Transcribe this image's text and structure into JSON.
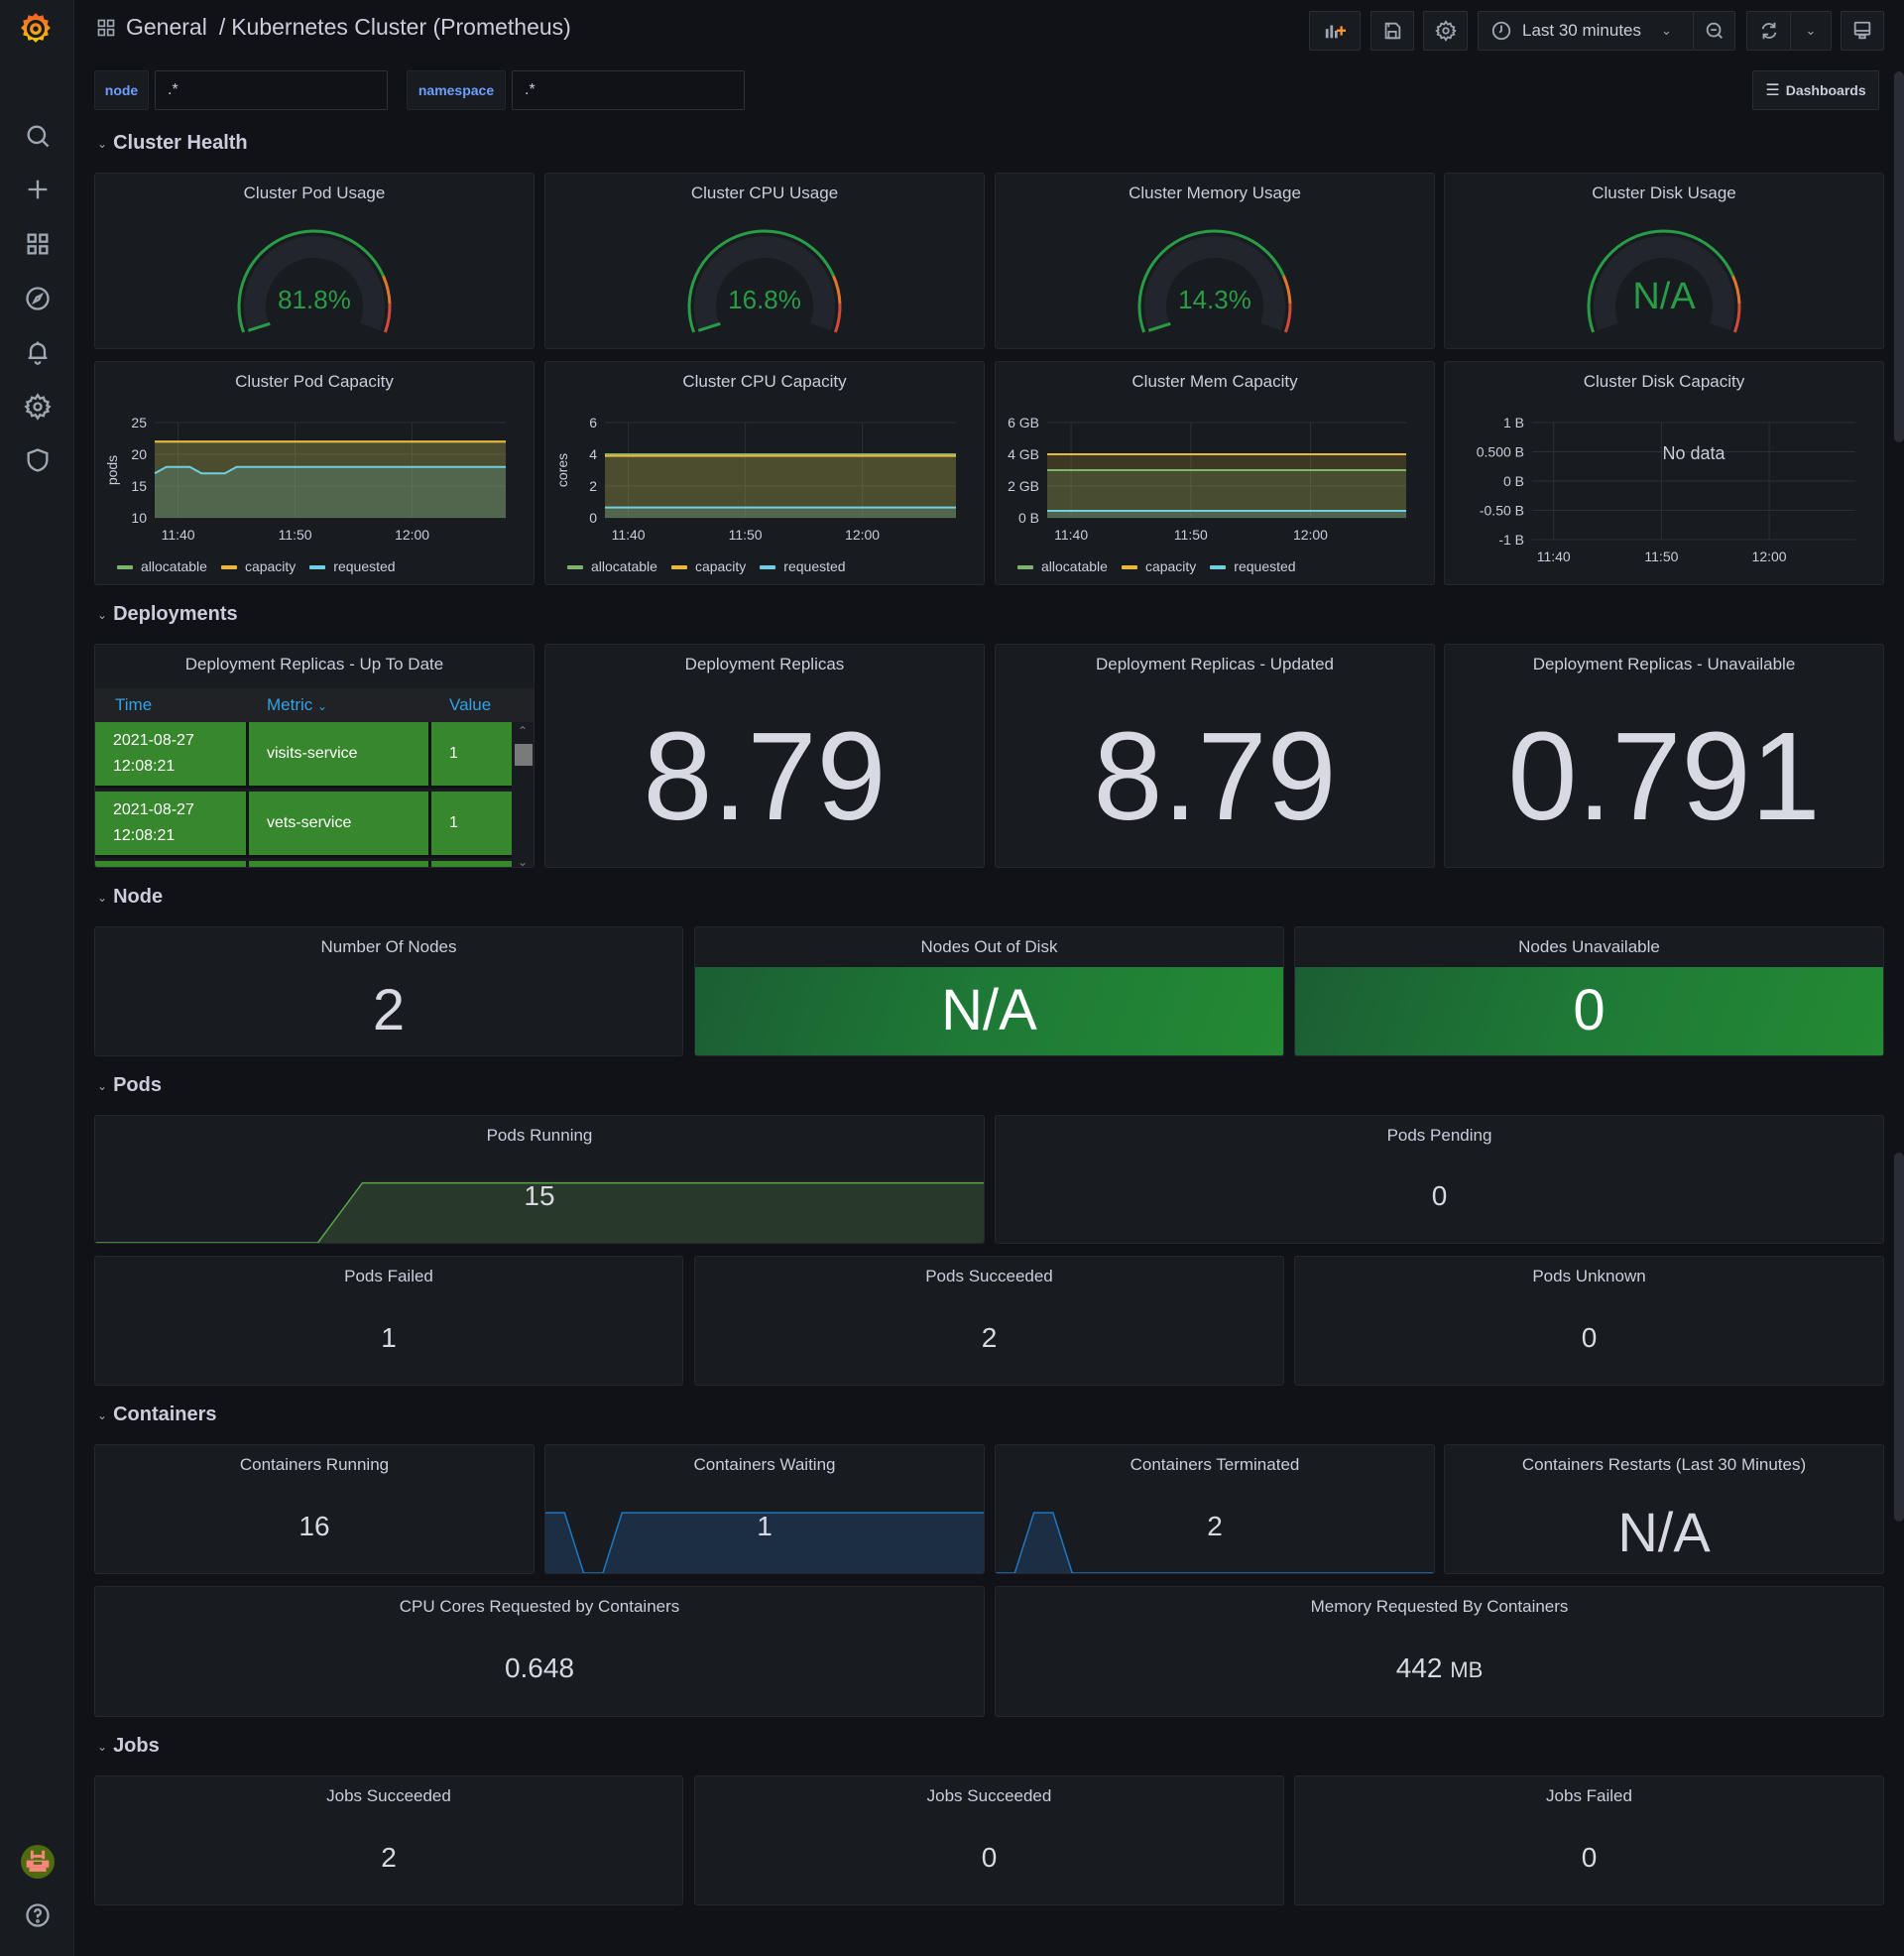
{
  "header": {
    "breadcrumb_folder": "General",
    "breadcrumb_sep": "/",
    "dashboard_title": "Kubernetes Cluster (Prometheus)",
    "time_range": "Last 30 minutes",
    "dashboards_button": "Dashboards"
  },
  "variables": [
    {
      "label": "node",
      "value": ".*"
    },
    {
      "label": "namespace",
      "value": ".*"
    }
  ],
  "sidebar": {
    "items": [
      "search",
      "create",
      "dashboards",
      "explore",
      "alerting",
      "configuration",
      "server-admin"
    ],
    "bottom": [
      "profile",
      "help"
    ]
  },
  "rows": {
    "cluster_health": "Cluster Health",
    "deployments": "Deployments",
    "node": "Node",
    "pods": "Pods",
    "containers": "Containers",
    "jobs": "Jobs"
  },
  "gauges": [
    {
      "title": "Cluster Pod Usage",
      "value": "81.8%",
      "percent": 81.8
    },
    {
      "title": "Cluster CPU Usage",
      "value": "16.8%",
      "percent": 16.8
    },
    {
      "title": "Cluster Memory Usage",
      "value": "14.3%",
      "percent": 14.3
    },
    {
      "title": "Cluster Disk Usage",
      "value": "N/A",
      "percent": null
    }
  ],
  "gauge_thresholds": {
    "green": "#299c46",
    "orange": "#e0752d",
    "red": "#d44a3a",
    "orange_from": 80,
    "red_from": 90
  },
  "chart_data": [
    {
      "type": "line",
      "title": "Cluster Pod Capacity",
      "ylabel": "pods",
      "x": [
        "11:38",
        "11:39",
        "11:40",
        "11:41",
        "11:42",
        "11:43",
        "11:44",
        "11:45",
        "11:50",
        "12:00",
        "12:08"
      ],
      "xticks": [
        "11:40",
        "11:50",
        "12:00"
      ],
      "yticks": [
        "10",
        "15",
        "20",
        "25"
      ],
      "ylim": [
        10,
        25
      ],
      "series": [
        {
          "name": "allocatable",
          "color": "#7eb26d",
          "values": [
            22,
            22,
            22,
            22,
            22,
            22,
            22,
            22,
            22,
            22,
            22
          ]
        },
        {
          "name": "capacity",
          "color": "#eab839",
          "values": [
            22,
            22,
            22,
            22,
            22,
            22,
            22,
            22,
            22,
            22,
            22
          ]
        },
        {
          "name": "requested",
          "color": "#6ed0e0",
          "values": [
            17,
            18,
            18,
            18,
            17,
            17,
            17,
            18,
            18,
            18,
            18
          ]
        }
      ]
    },
    {
      "type": "line",
      "title": "Cluster CPU Capacity",
      "ylabel": "cores",
      "x": [
        "11:38",
        "12:08"
      ],
      "xticks": [
        "11:40",
        "11:50",
        "12:00"
      ],
      "yticks": [
        "0",
        "2",
        "4",
        "6"
      ],
      "ylim": [
        0,
        6
      ],
      "series": [
        {
          "name": "allocatable",
          "color": "#7eb26d",
          "values": [
            4,
            4
          ]
        },
        {
          "name": "capacity",
          "color": "#eab839",
          "values": [
            3.9,
            3.9
          ]
        },
        {
          "name": "requested",
          "color": "#6ed0e0",
          "values": [
            0.65,
            0.65
          ]
        }
      ]
    },
    {
      "type": "line",
      "title": "Cluster Mem Capacity",
      "ylabel": "",
      "x": [
        "11:38",
        "12:08"
      ],
      "xticks": [
        "11:40",
        "11:50",
        "12:00"
      ],
      "yticks": [
        "0 B",
        "2 GB",
        "4 GB",
        "6 GB"
      ],
      "ylim": [
        0,
        6
      ],
      "series": [
        {
          "name": "allocatable",
          "color": "#7eb26d",
          "values": [
            3.0,
            3.0
          ]
        },
        {
          "name": "capacity",
          "color": "#eab839",
          "values": [
            4.0,
            4.0
          ]
        },
        {
          "name": "requested",
          "color": "#6ed0e0",
          "values": [
            0.44,
            0.44
          ]
        }
      ]
    },
    {
      "type": "line",
      "title": "Cluster Disk Capacity",
      "ylabel": "",
      "x": [],
      "xticks": [
        "11:40",
        "11:50",
        "12:00"
      ],
      "yticks": [
        "-1 B",
        "-0.50 B",
        "0 B",
        "0.500 B",
        "1 B"
      ],
      "ylim": [
        -1,
        1
      ],
      "no_data": "No data",
      "series": []
    }
  ],
  "deployments": {
    "table": {
      "title": "Deployment Replicas - Up To Date",
      "columns": [
        "Time",
        "Metric",
        "Value"
      ],
      "rows": [
        {
          "time": "2021-08-27 12:08:21",
          "time_date": "2021-08-27",
          "time_clock": "12:08:21",
          "metric": "visits-service",
          "value": "1"
        },
        {
          "time": "2021-08-27 12:08:21",
          "time_date": "2021-08-27",
          "time_clock": "12:08:21",
          "metric": "vets-service",
          "value": "1"
        }
      ]
    },
    "stats": [
      {
        "title": "Deployment Replicas",
        "value": "8.79"
      },
      {
        "title": "Deployment Replicas - Updated",
        "value": "8.79"
      },
      {
        "title": "Deployment Replicas - Unavailable",
        "value": "0.791"
      }
    ]
  },
  "node": [
    {
      "title": "Number Of Nodes",
      "value": "2"
    },
    {
      "title": "Nodes Out of Disk",
      "value": "N/A"
    },
    {
      "title": "Nodes Unavailable",
      "value": "0"
    }
  ],
  "pods": [
    {
      "title": "Pods Running",
      "value": "15",
      "sparkline": [
        0,
        0,
        0,
        0,
        0,
        0,
        15,
        15,
        15,
        15,
        15,
        15,
        15,
        15,
        15,
        15,
        15,
        15,
        15,
        15,
        15
      ]
    },
    {
      "title": "Pods Pending",
      "value": "0"
    },
    {
      "title": "Pods Failed",
      "value": "1"
    },
    {
      "title": "Pods Succeeded",
      "value": "2"
    },
    {
      "title": "Pods Unknown",
      "value": "0"
    }
  ],
  "containers": [
    {
      "title": "Containers Running",
      "value": "16"
    },
    {
      "title": "Containers Waiting",
      "value": "1",
      "sparkline": [
        1,
        1,
        0,
        0,
        1,
        1,
        1,
        1,
        1,
        1,
        1,
        1,
        1,
        1,
        1,
        1,
        1,
        1,
        1,
        1,
        1,
        1,
        1,
        1
      ]
    },
    {
      "title": "Containers Terminated",
      "value": "2",
      "sparkline": [
        0,
        0,
        1,
        1,
        0,
        0,
        0,
        0,
        0,
        0,
        0,
        0,
        0,
        0,
        0,
        0,
        0,
        0,
        0,
        0,
        0,
        0,
        0,
        0
      ]
    },
    {
      "title": "Containers Restarts (Last 30 Minutes)",
      "value": "N/A"
    },
    {
      "title": "CPU Cores Requested by Containers",
      "value": "0.648"
    },
    {
      "title": "Memory Requested By Containers",
      "value": "442",
      "unit": "MB"
    }
  ],
  "jobs": [
    {
      "title": "Jobs Succeeded",
      "value": "2"
    },
    {
      "title": "Jobs Succeeded",
      "value": "0"
    },
    {
      "title": "Jobs Failed",
      "value": "0"
    }
  ]
}
